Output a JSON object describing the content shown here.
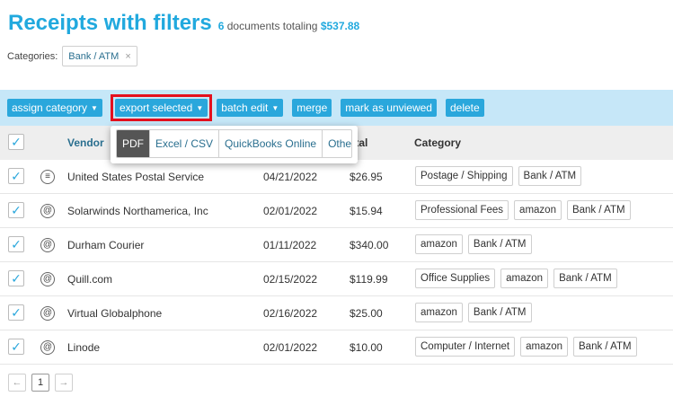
{
  "header": {
    "title": "Receipts with filters",
    "doc_count": "6",
    "summary_mid": " documents totaling ",
    "total_amount": "$537.88"
  },
  "filters": {
    "label": "Categories:",
    "chips": [
      {
        "label": "Bank / ATM",
        "remove": "×"
      }
    ]
  },
  "toolbar": {
    "assign_category": "assign category",
    "export_selected": "export selected",
    "batch_edit": "batch edit",
    "merge": "merge",
    "mark_unviewed": "mark as unviewed",
    "delete": "delete"
  },
  "export_menu": {
    "items": [
      "PDF",
      "Excel / CSV",
      "QuickBooks Online",
      "Other"
    ],
    "active_index": 0
  },
  "table": {
    "headers": {
      "vendor": "Vendor",
      "total": "otal",
      "category": "Category"
    },
    "check_mark": "✓",
    "rows": [
      {
        "icon": "envelope-icon",
        "vendor": "United States Postal Service",
        "date": "04/21/2022",
        "total": "$26.95",
        "tags": [
          "Postage / Shipping",
          "Bank / ATM"
        ]
      },
      {
        "icon": "at-icon",
        "vendor": "Solarwinds Northamerica, Inc",
        "date": "02/01/2022",
        "total": "$15.94",
        "tags": [
          "Professional Fees",
          "amazon",
          "Bank / ATM"
        ]
      },
      {
        "icon": "at-icon",
        "vendor": "Durham Courier",
        "date": "01/11/2022",
        "total": "$340.00",
        "tags": [
          "amazon",
          "Bank / ATM"
        ]
      },
      {
        "icon": "at-icon",
        "vendor": "Quill.com",
        "date": "02/15/2022",
        "total": "$119.99",
        "tags": [
          "Office Supplies",
          "amazon",
          "Bank / ATM"
        ]
      },
      {
        "icon": "at-icon",
        "vendor": "Virtual Globalphone",
        "date": "02/16/2022",
        "total": "$25.00",
        "tags": [
          "amazon",
          "Bank / ATM"
        ]
      },
      {
        "icon": "at-icon",
        "vendor": "Linode",
        "date": "02/01/2022",
        "total": "$10.00",
        "tags": [
          "Computer / Internet",
          "amazon",
          "Bank / ATM"
        ]
      }
    ]
  },
  "pager": {
    "prev": "←",
    "current": "1",
    "next": "→"
  },
  "colors": {
    "accent": "#21a9de",
    "toolbar_bg": "#c6e7f8",
    "highlight": "#e4101e"
  }
}
